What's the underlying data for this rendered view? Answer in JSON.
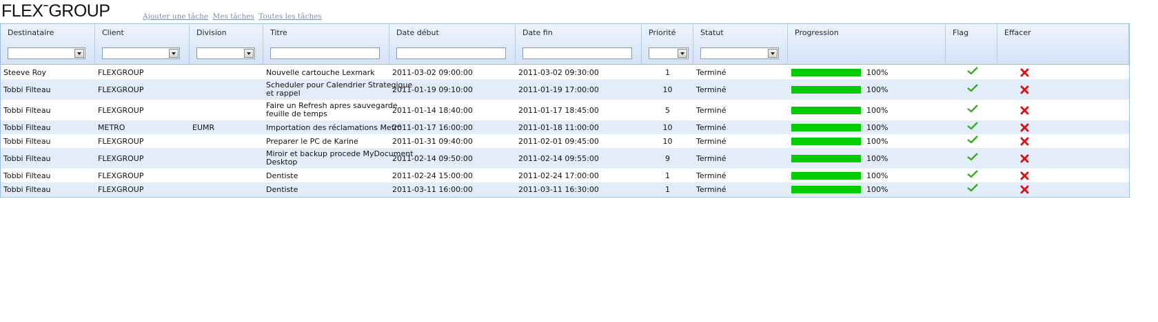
{
  "app": {
    "logo": "FLEXGROUP",
    "links": [
      "Ajouter une tâche",
      "Mes tâches",
      "Toutes les tâches"
    ]
  },
  "columns": [
    "Destinataire",
    "Client",
    "Division",
    "Titre",
    "Date début",
    "Date fin",
    "Priorité",
    "Statut",
    "Progression",
    "Flag",
    "Effacer"
  ],
  "filters": {
    "destinataire": "",
    "client": "",
    "division": "",
    "titre": "",
    "date_debut": "",
    "date_fin": "",
    "priorite": "",
    "statut": ""
  },
  "rows": [
    {
      "destinataire": "Steeve Roy",
      "client": "FLEXGROUP",
      "division": "",
      "titre": [
        "Nouvelle cartouche Lexmark"
      ],
      "date_debut": "2011-03-02 09:00:00",
      "date_fin": "2011-03-02 09:30:00",
      "priorite": "1",
      "statut": "Terminé",
      "progression_label": "100%",
      "progression": 1.0
    },
    {
      "destinataire": "Tobbi Filteau",
      "client": "FLEXGROUP",
      "division": "",
      "titre": [
        "Scheduler pour Calendrier Strategique",
        "et rappel"
      ],
      "date_debut": "2011-01-19 09:10:00",
      "date_fin": "2011-01-19 17:00:00",
      "priorite": "10",
      "statut": "Terminé",
      "progression_label": "100%",
      "progression": 1.0
    },
    {
      "destinataire": "Tobbi Filteau",
      "client": "FLEXGROUP",
      "division": "",
      "titre": [
        "Faire un Refresh apres sauvegarde",
        "feuille de temps"
      ],
      "date_debut": "2011-01-14 18:40:00",
      "date_fin": "2011-01-17 18:45:00",
      "priorite": "5",
      "statut": "Terminé",
      "progression_label": "100%",
      "progression": 1.0
    },
    {
      "destinataire": "Tobbi Filteau",
      "client": "METRO",
      "division": "EUMR",
      "titre": [
        "Importation des réclamations Metro"
      ],
      "date_debut": "2011-01-17 16:00:00",
      "date_fin": "2011-01-18 11:00:00",
      "priorite": "10",
      "statut": "Terminé",
      "progression_label": "100%",
      "progression": 1.0
    },
    {
      "destinataire": "Tobbi Filteau",
      "client": "FLEXGROUP",
      "division": "",
      "titre": [
        "Preparer le PC de Karine"
      ],
      "date_debut": "2011-01-31 09:40:00",
      "date_fin": "2011-02-01 09:45:00",
      "priorite": "10",
      "statut": "Terminé",
      "progression_label": "100%",
      "progression": 1.0
    },
    {
      "destinataire": "Tobbi Filteau",
      "client": "FLEXGROUP",
      "division": "",
      "titre": [
        "Miroir et backup procede MyDocument",
        "Desktop"
      ],
      "date_debut": "2011-02-14 09:50:00",
      "date_fin": "2011-02-14 09:55:00",
      "priorite": "9",
      "statut": "Terminé",
      "progression_label": "100%",
      "progression": 1.0
    },
    {
      "destinataire": "Tobbi Filteau",
      "client": "FLEXGROUP",
      "division": "",
      "titre": [
        "Dentiste"
      ],
      "date_debut": "2011-02-24 15:00:00",
      "date_fin": "2011-02-24 17:00:00",
      "priorite": "1",
      "statut": "Terminé",
      "progression_label": "100%",
      "progression": 1.0
    },
    {
      "destinataire": "Tobbi Filteau",
      "client": "FLEXGROUP",
      "division": "",
      "titre": [
        "Dentiste"
      ],
      "date_debut": "2011-03-11 16:00:00",
      "date_fin": "2011-03-11 16:30:00",
      "priorite": "1",
      "statut": "Terminé",
      "progression_label": "100%",
      "progression": 1.0
    }
  ],
  "colors": {
    "progress": "#00cc00",
    "check": "#33aa22",
    "delete": "#dd1111",
    "alt_row": "#e3edf9",
    "header": "#d4e3f6"
  }
}
